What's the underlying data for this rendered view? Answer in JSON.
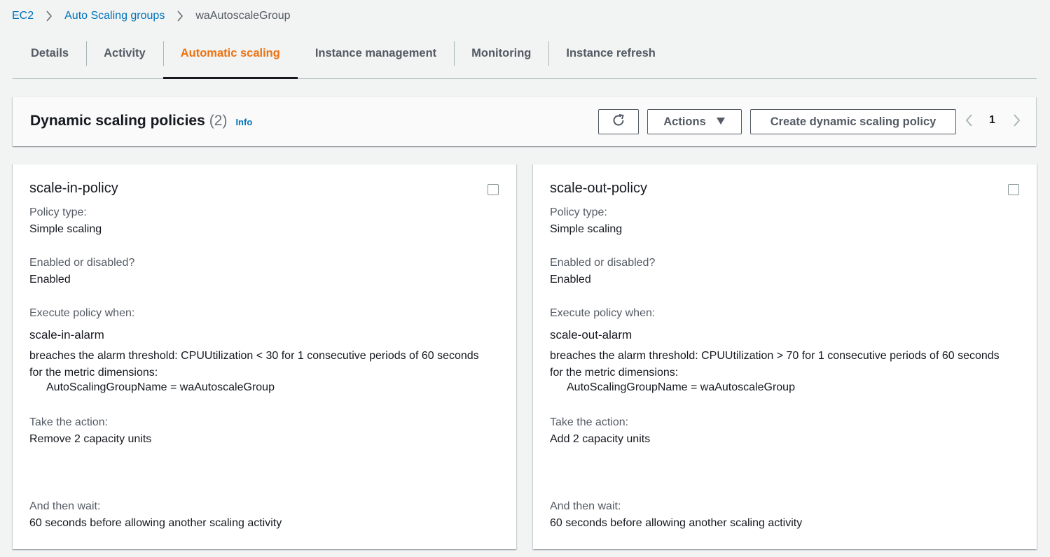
{
  "breadcrumb": {
    "items": [
      "EC2",
      "Auto Scaling groups"
    ],
    "current": "waAutoscaleGroup"
  },
  "tabs": [
    {
      "label": "Details",
      "active": false
    },
    {
      "label": "Activity",
      "active": false
    },
    {
      "label": "Automatic scaling",
      "active": true
    },
    {
      "label": "Instance management",
      "active": false
    },
    {
      "label": "Monitoring",
      "active": false
    },
    {
      "label": "Instance refresh",
      "active": false
    }
  ],
  "header": {
    "title": "Dynamic scaling policies",
    "count": "(2)",
    "info": "Info",
    "refresh_icon": "refresh-icon",
    "actions_label": "Actions",
    "create_label": "Create dynamic scaling policy",
    "page": "1"
  },
  "labels": {
    "policy_type": "Policy type:",
    "enabled": "Enabled or disabled?",
    "execute_when": "Execute policy when:",
    "take_action": "Take the action:",
    "then_wait": "And then wait:"
  },
  "policies": [
    {
      "name": "scale-in-policy",
      "policy_type": "Simple scaling",
      "enabled": "Enabled",
      "alarm_name": "scale-in-alarm",
      "alarm_threshold": "breaches the alarm threshold: CPUUtilization < 30 for 1 consecutive periods of 60 seconds for the metric dimensions:",
      "alarm_dimension": "AutoScalingGroupName = waAutoscaleGroup",
      "action": "Remove 2 capacity units",
      "wait": "60 seconds before allowing another scaling activity"
    },
    {
      "name": "scale-out-policy",
      "policy_type": "Simple scaling",
      "enabled": "Enabled",
      "alarm_name": "scale-out-alarm",
      "alarm_threshold": "breaches the alarm threshold: CPUUtilization > 70 for 1 consecutive periods of 60 seconds for the metric dimensions:",
      "alarm_dimension": "AutoScalingGroupName = waAutoscaleGroup",
      "action": "Add 2 capacity units",
      "wait": "60 seconds before allowing another scaling activity"
    }
  ],
  "colors": {
    "link": "#0073bb",
    "active_tab": "#ec7211",
    "background": "#f2f3f3"
  }
}
